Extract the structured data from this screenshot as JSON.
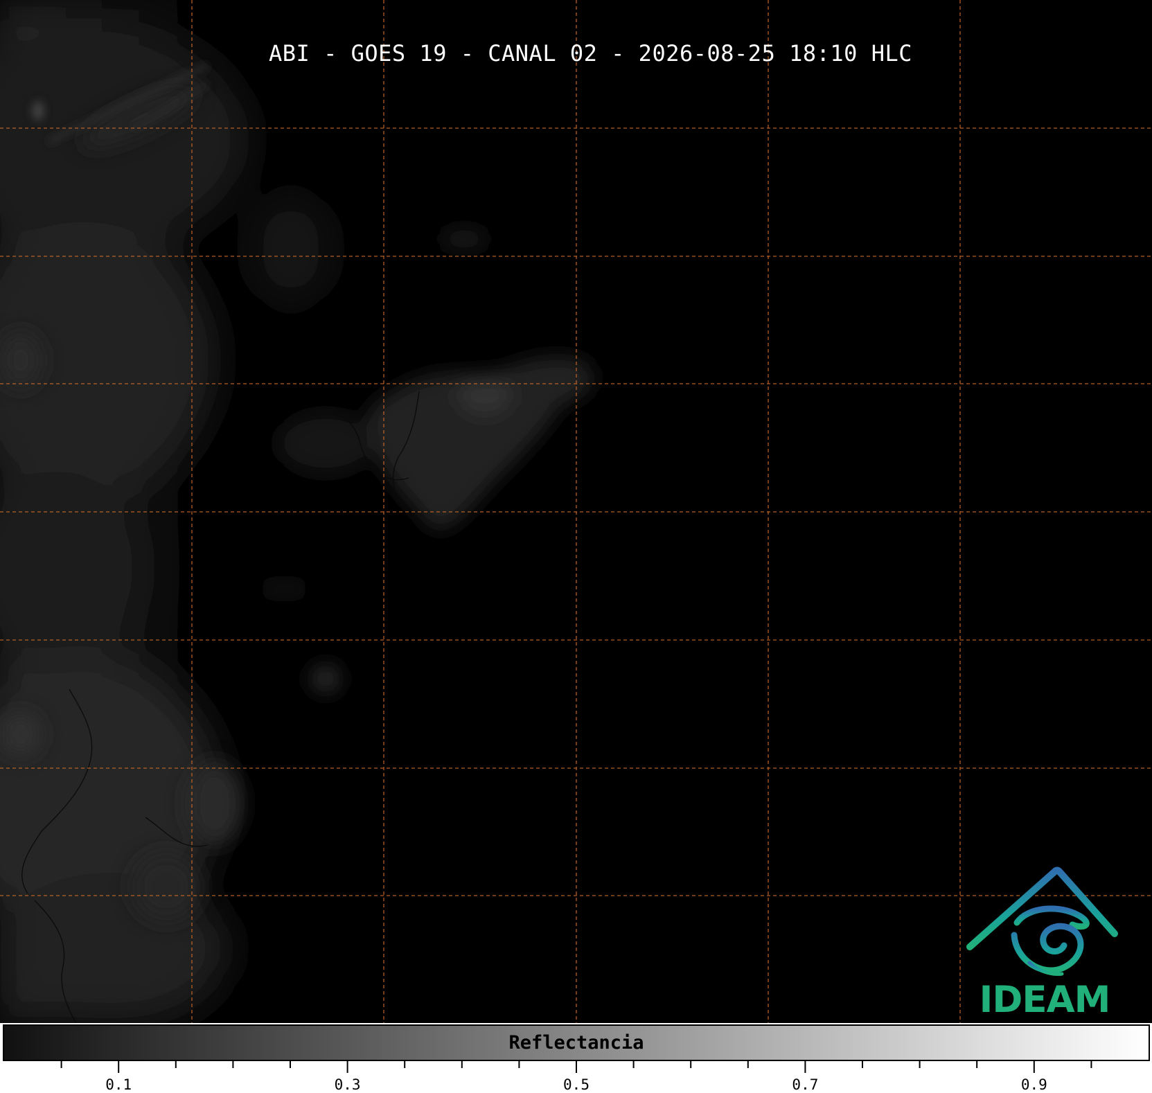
{
  "title": "ABI - GOES 19 - CANAL 02 - 2026-08-25 18:10 HLC",
  "logo": {
    "text": "IDEAM",
    "icon": "ideam-logo-icon",
    "colors": {
      "blue": "#2f6fb0",
      "teal": "#1aa39a",
      "green": "#21b07a"
    }
  },
  "colorbar": {
    "label": "Reflectancia",
    "range": [
      0,
      1
    ],
    "colors": {
      "low": "#111111",
      "high": "#ffffff"
    },
    "major_ticks": [
      0.1,
      0.3,
      0.5,
      0.7,
      0.9
    ],
    "major_labels": [
      "0.1",
      "0.3",
      "0.5",
      "0.7",
      "0.9"
    ],
    "minor_ticks": [
      0.05,
      0.15,
      0.2,
      0.25,
      0.35,
      0.4,
      0.45,
      0.55,
      0.6,
      0.65,
      0.75,
      0.8,
      0.85,
      0.95
    ]
  },
  "grid": {
    "color": "#c8692a",
    "style": "dashed",
    "visible": true
  }
}
